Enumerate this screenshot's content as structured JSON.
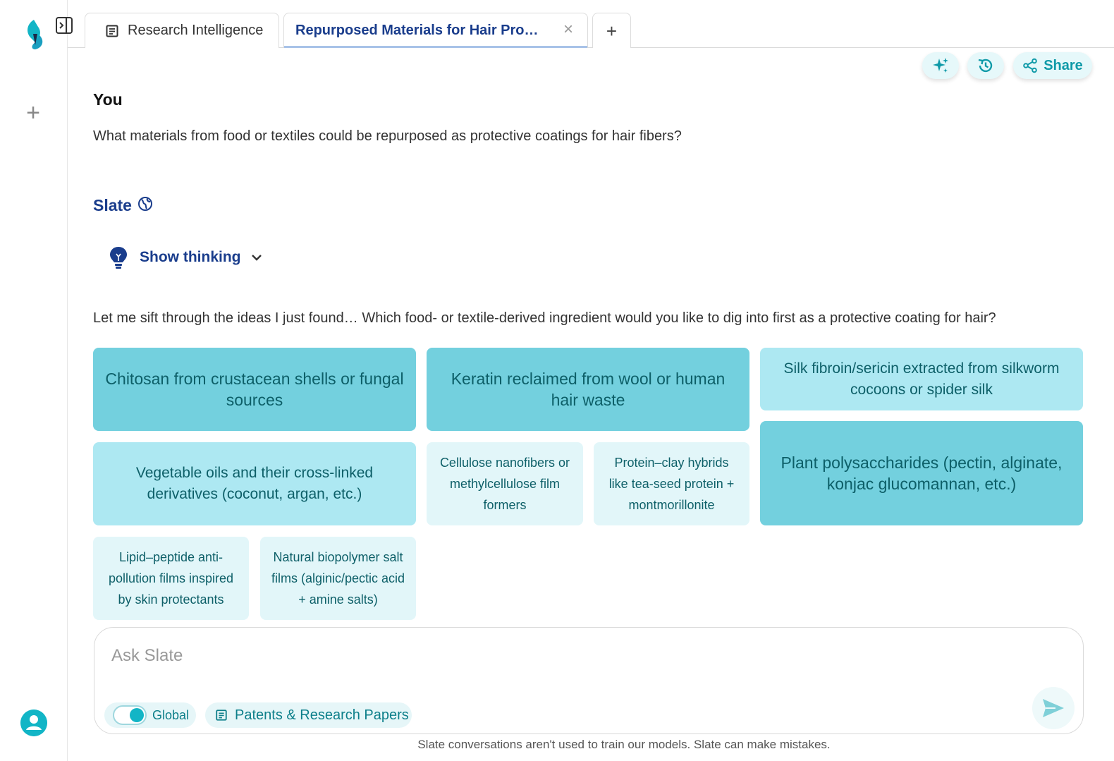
{
  "colors": {
    "accent": "#12b5c6",
    "title_blue": "#1a3d8c",
    "card_dark": "#73d0de",
    "card_mid": "#ade8f2",
    "card_light": "#e2f6f9"
  },
  "rail": {
    "logo_icon": "slate-logo-icon",
    "collapse_icon": "sidebar-collapse-icon",
    "new_chat_icon": "plus-icon",
    "profile_icon": "user-avatar-icon"
  },
  "tabs": [
    {
      "label": "Research Intelligence",
      "icon": "document-icon"
    },
    {
      "label": "Repurposed Materials for Hair Pro…",
      "active": true,
      "close_icon": "close-icon"
    },
    {
      "label": "+",
      "icon": "plus-icon"
    }
  ],
  "actions": {
    "sparkle_icon": "sparkle-icon",
    "history_icon": "history-icon",
    "share_label": "Share"
  },
  "conversation": {
    "user_label": "You",
    "user_question": "What materials from food or textiles could be repurposed as protective coatings for hair fibers?",
    "assistant_label": "Slate",
    "assistant_icon": "globe-icon",
    "thinking_label": "Show thinking",
    "prompt": "Let me sift through the ideas I just found… Which food- or textile-derived ingredient would you like to dig into first as a protective coating for hair?"
  },
  "options": [
    {
      "text": "Chitosan from crustacean shells or fungal sources",
      "shade": "dark"
    },
    {
      "text": "Keratin reclaimed from wool or human hair waste",
      "shade": "dark"
    },
    {
      "text": "Silk fibroin/sericin extracted from silkworm cocoons or spider silk",
      "shade": "mid"
    },
    {
      "text": "Vegetable oils and their cross-linked derivatives (coconut, argan, etc.)",
      "shade": "mid"
    },
    {
      "text": "Cellulose nanofibers or methylcellulose film formers",
      "shade": "light"
    },
    {
      "text": "Protein–clay hybrids like tea-seed protein + montmorillonite",
      "shade": "light"
    },
    {
      "text": "Plant polysaccharides (pectin, alginate, konjac glucomannan, etc.)",
      "shade": "dark"
    },
    {
      "text": "Lipid–peptide anti-pollution films inspired by skin protectants",
      "shade": "light"
    },
    {
      "text": "Natural biopolymer salt films (alginic/pectic acid + amine salts)",
      "shade": "light"
    }
  ],
  "composer": {
    "placeholder": "Ask Slate",
    "scope_toggle_label": "Global",
    "scope_toggle_on": true,
    "source_label": "Patents & Research Papers",
    "source_icon": "document-icon",
    "send_icon": "send-icon"
  },
  "footer": {
    "disclaimer": "Slate conversations aren't used to train our models. Slate can make mistakes."
  }
}
